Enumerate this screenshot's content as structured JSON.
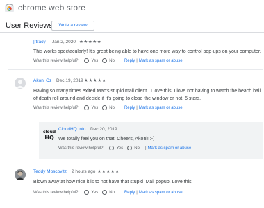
{
  "app": {
    "title": "chrome web store"
  },
  "header": {
    "title": "User Reviews",
    "write_button": "Write a review"
  },
  "reviews": [
    {
      "name": "| tracy",
      "date": "Jan 2, 2020",
      "stars": "★★★★★",
      "text": "This works spectacularly! It's great being able to have one more way to control pop-ups on your computer.",
      "helpful": {
        "question": "Was this review helpful?",
        "yes": "Yes",
        "no": "No",
        "reply": "Reply",
        "spam": "Mark as spam or abuse"
      }
    },
    {
      "name": "Akoni Oz",
      "date": "Dec 19, 2019",
      "stars": "★★★★★",
      "text_lines": [
        "Having so many times exited Mac's stupid mail client...I love this. I love not having to watch the beach ball",
        "of death roll around and decide if it's going to close the window or not. 5 stars."
      ],
      "helpful": {
        "question": "Was this review helpful?",
        "yes": "Yes",
        "no": "No",
        "reply": "Reply",
        "spam": "Mark as spam or abuse"
      },
      "developer_reply": {
        "logo_text": [
          "cloud",
          "HQ"
        ],
        "name": "CloudHQ Info",
        "date": "Dec 20, 2019",
        "text": "We totally feel you on that. Cheers, Akoni! :-)",
        "helpful": {
          "question": "Was this review helpful?",
          "yes": "Yes",
          "no": "No",
          "spam": "Mark as spam or abuse"
        }
      }
    },
    {
      "name": "Teddy Moscovitz",
      "date": "2 hours ago",
      "stars": "★★★★★",
      "text": "Blown away at how nice it is to not have that stupid iMail popup. Love this!",
      "helpful": {
        "question": "Was this review helpful?",
        "yes": "Yes",
        "no": "No",
        "reply": "Reply",
        "spam": "Mark as spam or abuse"
      }
    }
  ],
  "colors": {
    "link": "#1a73e8",
    "text": "#3c4043",
    "muted": "#5f6368",
    "reply_bg": "#f1f3f4"
  }
}
